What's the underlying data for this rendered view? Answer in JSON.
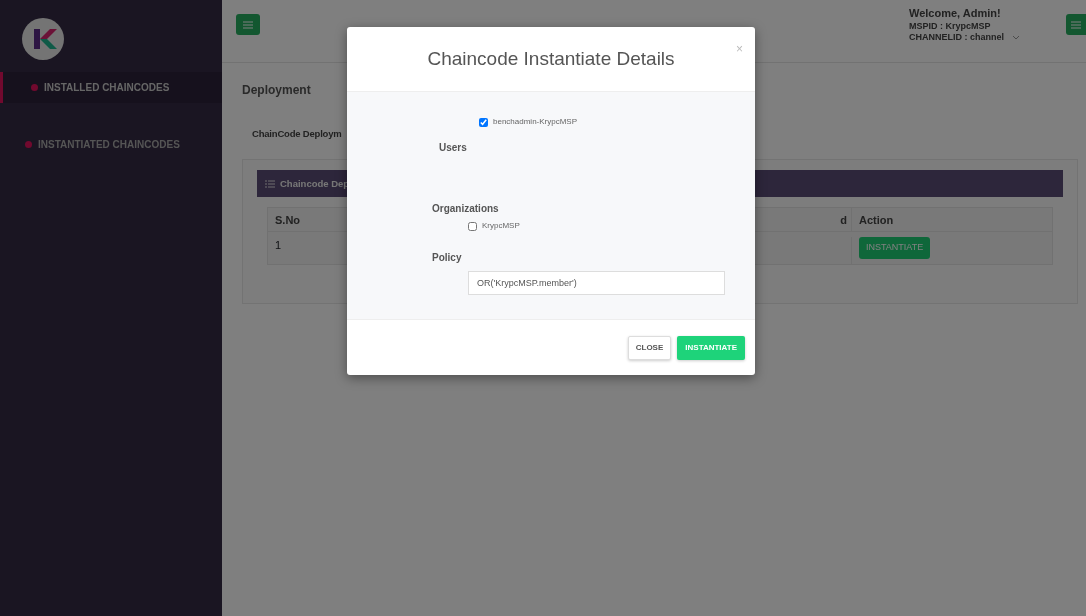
{
  "sidebar": {
    "items": [
      {
        "label": "INSTALLED CHAINCODES",
        "selected": true
      },
      {
        "label": "INSTANTIATED CHAINCODES",
        "selected": false
      }
    ]
  },
  "header": {
    "welcome": "Welcome, Admin!",
    "mspid": "MSPID : KrypcMSP",
    "channel": "CHANNELID : channel"
  },
  "page": {
    "breadcrumb": "Deployment",
    "section_title": "ChainCode Deploym",
    "panel_title": "Chaincode Dep",
    "table": {
      "columns": [
        "S.No",
        "d",
        "Action"
      ],
      "rows": [
        {
          "sno": "1",
          "action": "INSTANTIATE"
        }
      ]
    }
  },
  "modal": {
    "title": "Chaincode Instantiate Details",
    "close_symbol": "×",
    "users": [
      {
        "label": "benchadmin-KrypcMSP",
        "checked": true
      }
    ],
    "users_label": "Users",
    "organizations_label": "Organizations",
    "organizations": [
      {
        "label": "KrypcMSP",
        "checked": false
      }
    ],
    "policy_label": "Policy",
    "policy_value": "OR('KrypcMSP.member')",
    "buttons": [
      {
        "label": "CLOSE",
        "kind": "secondary"
      },
      {
        "label": "INSTANTIATE",
        "kind": "primary"
      }
    ]
  }
}
